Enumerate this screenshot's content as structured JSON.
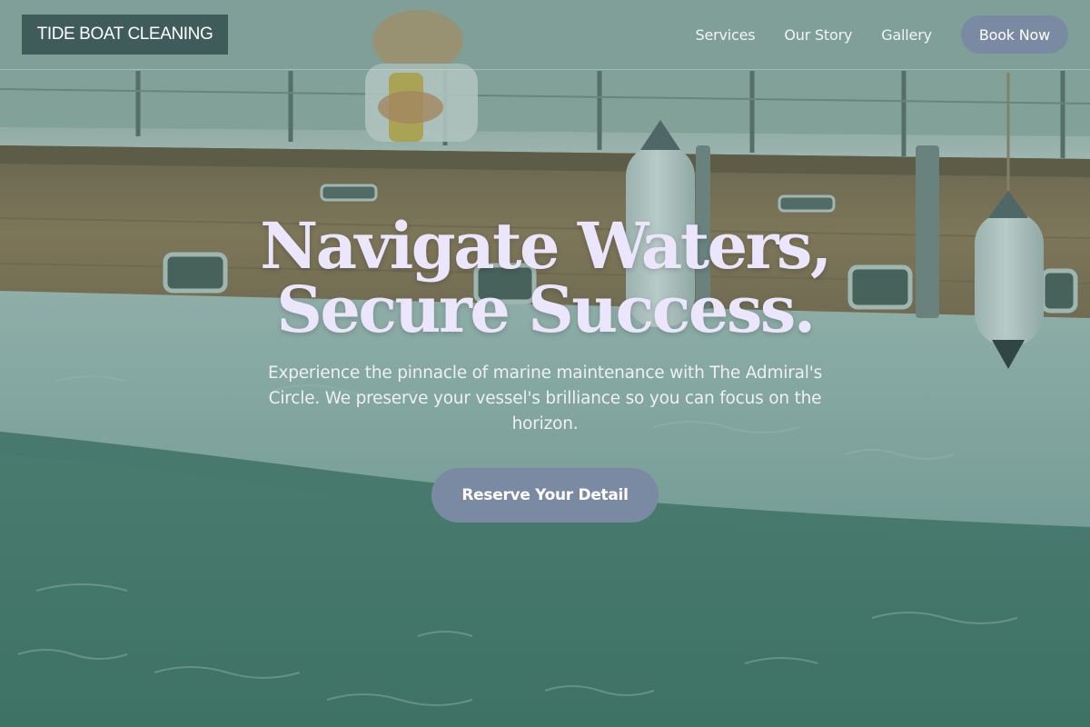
{
  "brand": {
    "name": "TIDE BOAT CLEANING"
  },
  "nav": {
    "links": [
      "Services",
      "Our Story",
      "Gallery"
    ],
    "book_label": "Book Now"
  },
  "hero": {
    "headline_line1": "Navigate Waters,",
    "headline_line2": "Secure Success.",
    "subtext": "Experience the pinnacle of marine maintenance with The Admiral's Circle. We preserve your vessel's brilliance so you can focus on the horizon.",
    "cta_label": "Reserve Your Detail"
  },
  "colors": {
    "brand_bg": "#3f5c5b",
    "button_bg": "#7b8aa3",
    "headline_text": "#ebe6fb",
    "water": "#4f7f74"
  }
}
